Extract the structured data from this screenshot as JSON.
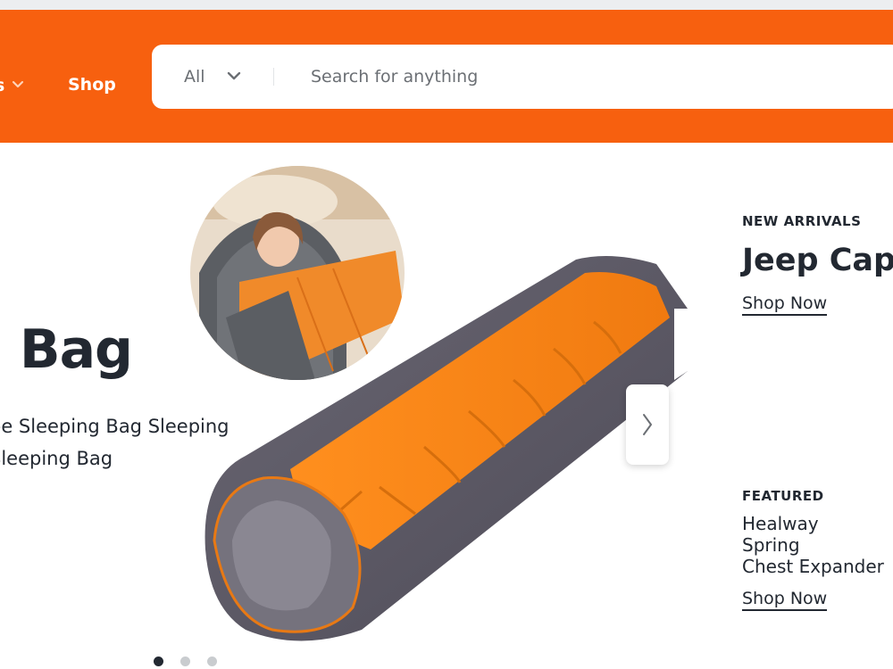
{
  "header": {
    "category_label": "s",
    "shop_label": "Shop",
    "search_scope": "All",
    "search_placeholder": "Search for anything",
    "brand_color": "#f7600f"
  },
  "hero": {
    "title": "g Bag",
    "subtitle_lines": [
      "pe Sleeping Bag Sleeping",
      "Sleeping Bag"
    ],
    "next_icon": "chevron-right-icon",
    "slides_total": 3,
    "active_slide": 1
  },
  "promos": [
    {
      "label": "NEW ARRIVALS",
      "title_lines": [
        "Jeep Cap"
      ],
      "cta": "Shop Now"
    },
    {
      "label": "FEATURED",
      "title_lines": [
        "Healway",
        "Spring",
        "Chest Expander"
      ],
      "cta": "Shop Now"
    }
  ]
}
